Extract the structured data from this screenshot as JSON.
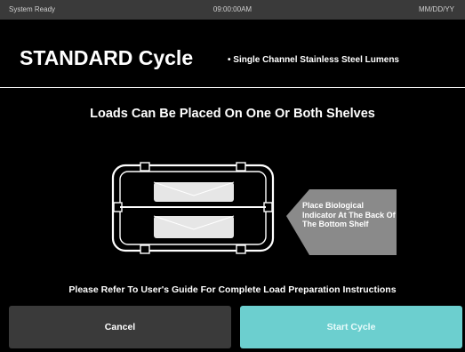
{
  "status_bar": {
    "status_text": "System Ready",
    "time": "09:00:00AM",
    "date": "MM/DD/YY"
  },
  "header": {
    "title": "STANDARD Cycle",
    "subtitle": "• Single Channel Stainless Steel Lumens"
  },
  "main": {
    "heading": "Loads Can Be Placed On One Or Both Shelves",
    "indicator_callout": "Place Biological Indicator At The Back Of The Bottom Shelf",
    "footer_note": "Please Refer To User's Guide For Complete Load Preparation Instructions"
  },
  "buttons": {
    "cancel_label": "Cancel",
    "start_label": "Start Cycle"
  },
  "icons": {
    "shelf_diagram": "chamber-shelves-icon",
    "callout_arrow": "arrow-left-icon"
  },
  "colors": {
    "background": "#000000",
    "status_bar": "#3a3a3a",
    "cancel_button": "#3a3a3a",
    "start_button": "#6ccfcf",
    "callout": "#8a8a8a"
  }
}
